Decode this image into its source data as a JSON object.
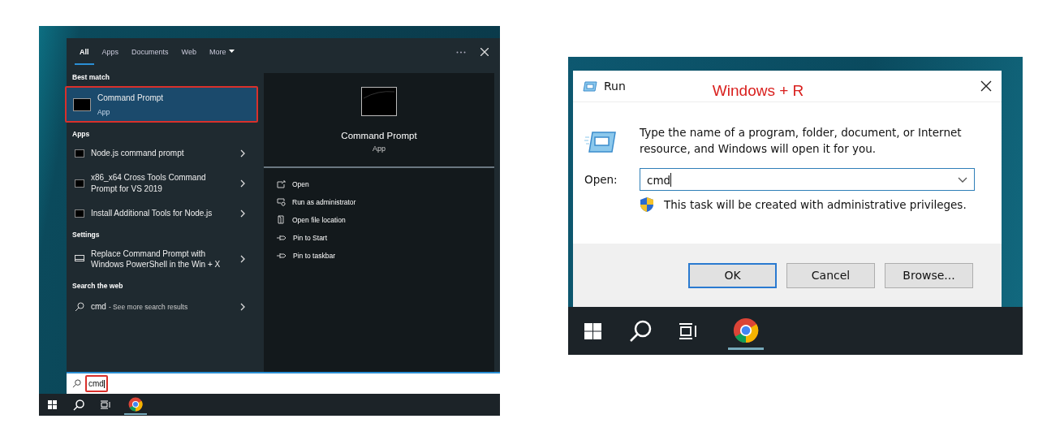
{
  "search_panel": {
    "tabs": [
      {
        "label": "All",
        "selected": true,
        "kind": "tab"
      },
      {
        "label": "Apps",
        "selected": false,
        "kind": "tab"
      },
      {
        "label": "Documents",
        "selected": false,
        "kind": "tab"
      },
      {
        "label": "Web",
        "selected": false,
        "kind": "tab"
      },
      {
        "label": "More",
        "selected": false,
        "kind": "menu"
      }
    ],
    "sections": [
      {
        "heading": "Best match",
        "items": [
          {
            "kind": "best",
            "title": "Command Prompt",
            "subtitle": "App",
            "selected": true,
            "highlighted": true
          }
        ]
      },
      {
        "heading": "Apps",
        "items": [
          {
            "kind": "app",
            "title": "Node.js command prompt",
            "selected": false,
            "highlighted": false
          },
          {
            "kind": "app",
            "title": "x86_x64 Cross Tools Command Prompt for VS 2019",
            "selected": false,
            "highlighted": false
          },
          {
            "kind": "app",
            "title": "Install Additional Tools for Node.js",
            "selected": false,
            "highlighted": false
          }
        ]
      },
      {
        "heading": "Settings",
        "items": [
          {
            "kind": "setting",
            "title": "Replace Command Prompt with Windows PowerShell in the Win + X",
            "selected": false,
            "highlighted": false
          }
        ]
      },
      {
        "heading": "Search the web",
        "items": [
          {
            "kind": "web",
            "title": "cmd",
            "subtitle": "- See more search results",
            "selected": false,
            "highlighted": false
          }
        ]
      }
    ],
    "preview": {
      "title": "Command Prompt",
      "subtitle": "App",
      "actions": [
        {
          "kind": "open",
          "label": "Open"
        },
        {
          "kind": "admin",
          "label": "Run as administrator"
        },
        {
          "kind": "location",
          "label": "Open file location"
        },
        {
          "kind": "pin",
          "label": "Pin to Start"
        },
        {
          "kind": "pin",
          "label": "Pin to taskbar"
        }
      ]
    },
    "search_box": {
      "value": "cmd",
      "highlighted": true
    }
  },
  "run_dialog": {
    "title": "Run",
    "annotation": "Windows + R",
    "description": "Type the name of a program, folder, document, or Internet resource, and Windows will open it for you.",
    "open_label": "Open:",
    "open_value": "cmd",
    "admin_note": "This task will be created with administrative privileges.",
    "buttons": [
      {
        "label": "OK",
        "default": true
      },
      {
        "label": "Cancel",
        "default": false
      },
      {
        "label": "Browse...",
        "default": false
      }
    ]
  }
}
